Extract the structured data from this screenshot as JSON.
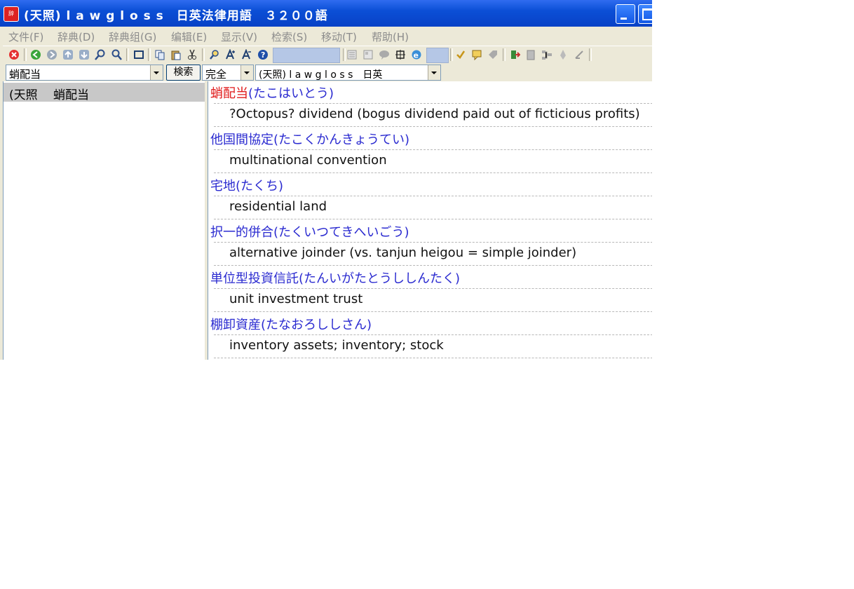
{
  "window": {
    "title": "(天照) l a w g l o s s　日英法律用語　３２００語"
  },
  "menu": [
    "文件(F)",
    "辞典(D)",
    "辞典组(G)",
    "编辑(E)",
    "显示(V)",
    "检索(S)",
    "移动(T)",
    "帮助(H)"
  ],
  "toolbar": {
    "icons": [
      "close-icon",
      "back-icon",
      "forward-icon",
      "up-icon",
      "down-icon",
      "search-icon",
      "search-next-icon",
      "fullscreen-icon",
      "copy-icon",
      "paste-icon",
      "cut-icon",
      "zoom-icon",
      "font-larger-icon",
      "font-smaller-icon",
      "help-icon",
      "list-icon",
      "dict-icon",
      "bubble-icon",
      "layout-icon",
      "ie-icon",
      "mark-icon",
      "note-icon",
      "tag-icon",
      "exit-icon",
      "clipboard-icon",
      "tree-icon",
      "pen-icon",
      "edit-icon"
    ]
  },
  "search": {
    "query": "蛸配当",
    "button_label": "検索",
    "mode": "完全",
    "dictionary": "(天照) l a w g l o s s　日英"
  },
  "results": {
    "items": [
      "(天照　 蛸配当"
    ]
  },
  "entries": [
    {
      "headword": "蛸配当",
      "reading": "(たこはいとう)",
      "definition": "?Octopus? dividend (bogus dividend paid out of ficticious profits)"
    },
    {
      "headword": "他国間協定",
      "reading": "(たこくかんきょうてい)",
      "definition": "multinational convention"
    },
    {
      "headword": "宅地",
      "reading": "(たくち)",
      "definition": "residential land"
    },
    {
      "headword": "択一的併合",
      "reading": "(たくいつてきへいごう)",
      "definition": "alternative joinder (vs. tanjun heigou = simple joinder)"
    },
    {
      "headword": "単位型投資信託",
      "reading": "(たんいがたとうししんたく)",
      "definition": "unit investment trust"
    },
    {
      "headword": "棚卸資産",
      "reading": "(たなおろししさん)",
      "definition": "inventory assets; inventory; stock"
    }
  ],
  "colors": {
    "titlebar": "#0b4fd6",
    "headword_active": "#e01a1a",
    "headword": "#2a2ad0"
  }
}
